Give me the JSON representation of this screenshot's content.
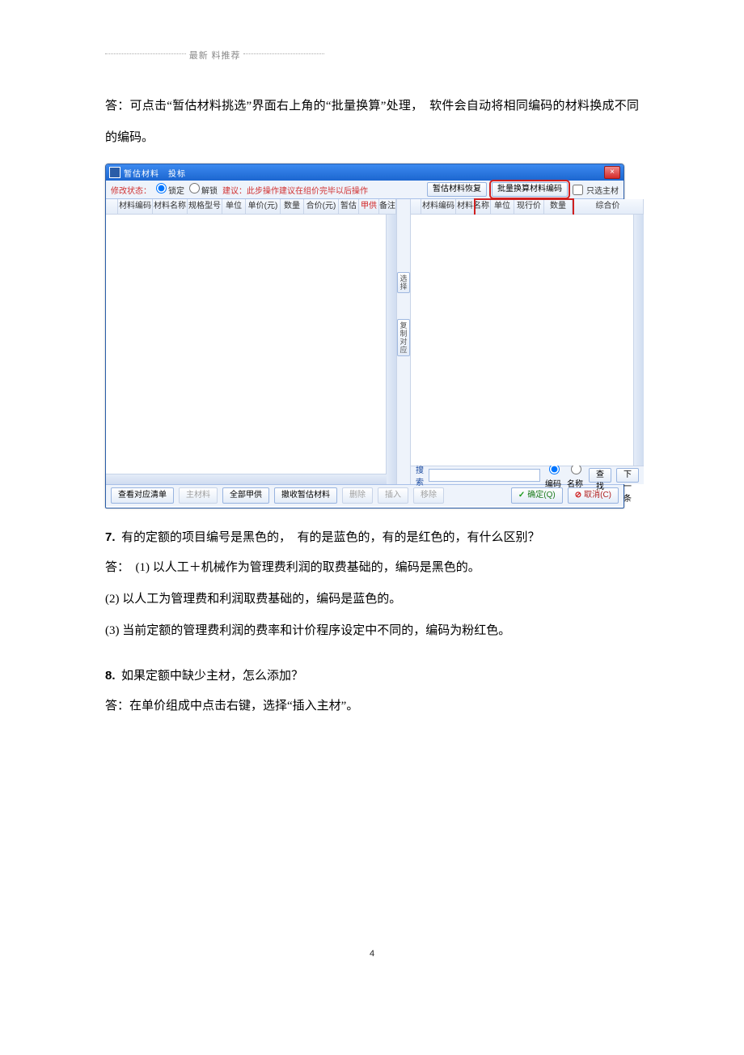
{
  "doc": {
    "header_text": "最新 料推荐",
    "paragraph_a": "答：可点击“暂估材料挑选”界面右上角的“批量换算”处理，　软件会自动将相同编码的材料换成不同的编码。",
    "q7": "有的定额的项目编号是黑色的，　有的是蓝色的，有的是红色的，有什么区别？",
    "a7_1": "答： (1) 以人工＋机械作为管理费利润的取费基础的，编码是黑色的。",
    "a7_2": "(2) 以人工为管理费和利润取费基础的，编码是蓝色的。",
    "a7_3": "(3) 当前定额的管理费利润的费率和计价程序设定中不同的，编码为粉红色。",
    "q8": "如果定额中缺少主材，怎么添加？",
    "a8": "答：在单价组成中点击右键，选择“插入主材”。",
    "page_no": "4"
  },
  "window": {
    "title": "暂估材料　投标",
    "close": "×",
    "toolbar": {
      "status_label": "修改状态：",
      "radio_lock": "锁定",
      "radio_unlock": "解锁",
      "hint": "建议：此步操作建议在组价完毕以后操作",
      "btn_restore": "暂估材料恢复",
      "btn_batch": "批量换算材料编码",
      "chk_main": "只选主材"
    },
    "left_cols": [
      "材料编码",
      "材料名称",
      "规格型号",
      "单位",
      "单价(元)",
      "数量",
      "合价(元)",
      "暂估",
      "甲供",
      "备注"
    ],
    "right_cols": [
      "材料编码",
      "材料名称",
      "单位",
      "现行价",
      "数量",
      "综合价"
    ],
    "mid_buttons": {
      "select": "选\n择",
      "copy": "复\n制\n对\n应"
    },
    "search": {
      "label": "搜索",
      "radio_code": "编码",
      "radio_name": "名称",
      "btn_find": "查找",
      "btn_next": "下一条",
      "placeholder": ""
    },
    "bottom": {
      "btn_view": "查看对应清单",
      "btn_main": "主材料",
      "btn_all_owner": "全部甲供",
      "btn_retract": "撤收暂估材料",
      "btn_del": "删除",
      "btn_insert": "插入",
      "btn_remove": "移除",
      "btn_ok": "确定(Q)",
      "btn_cancel": "取消(C)"
    }
  }
}
